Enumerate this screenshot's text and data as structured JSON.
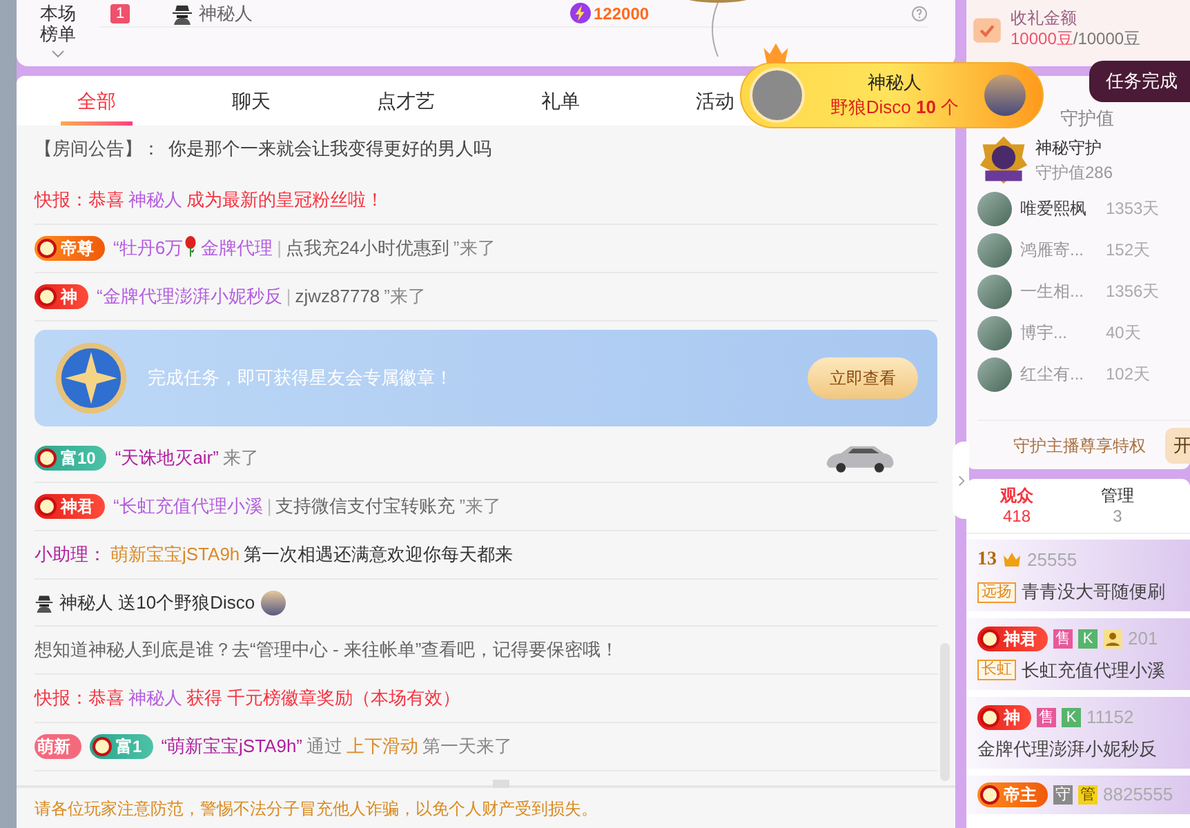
{
  "leaderboard": {
    "label": "本场榜单",
    "rank": "1",
    "name": "神秘人",
    "score": "122000"
  },
  "anchor_task": {
    "label": "收礼金额",
    "done": "10000豆",
    "total": "/10000豆"
  },
  "toast": "任务完成",
  "gift_banner": {
    "sender": "神秘人",
    "gift": "野狼Disco",
    "count": "10",
    "unit": "个"
  },
  "chat_tabs": [
    {
      "label": "全部",
      "selected": true
    },
    {
      "label": "聊天",
      "selected": false
    },
    {
      "label": "点才艺",
      "selected": false
    },
    {
      "label": "礼单",
      "selected": false
    },
    {
      "label": "活动",
      "selected": false
    }
  ],
  "announcement": {
    "label": "【房间公告】：",
    "text": "你是那个一来就会让我变得更好的男人吗"
  },
  "messages": [
    {
      "kind": "text",
      "segments": [
        {
          "kind": "alert",
          "text": "快报：恭喜"
        },
        {
          "kind": "name",
          "text": "神秘人"
        },
        {
          "kind": "alert",
          "text": "成为最新的皇冠粉丝啦！"
        }
      ]
    },
    {
      "kind": "text",
      "badges": [
        {
          "kind": "emperor",
          "label": "帝尊"
        }
      ],
      "segments": [
        {
          "kind": "name",
          "text": "“牡丹6万"
        },
        {
          "kind": "rose"
        },
        {
          "kind": "name",
          "text": "金牌代理"
        },
        {
          "kind": "sep",
          "text": "|"
        },
        {
          "kind": "body",
          "text": "点我充24小时优惠到"
        },
        {
          "kind": "muted",
          "text": "”来了"
        }
      ]
    },
    {
      "kind": "text",
      "badges": [
        {
          "kind": "god",
          "label": "神"
        }
      ],
      "segments": [
        {
          "kind": "name",
          "text": "“金牌代理澎湃小妮秒反"
        },
        {
          "kind": "sep",
          "text": "|"
        },
        {
          "kind": "body",
          "text": "zjwz87778"
        },
        {
          "kind": "muted",
          "text": "”来了"
        }
      ]
    },
    {
      "kind": "promo",
      "text": "完成任务，即可获得星友会专属徽章！",
      "button": "立即查看"
    },
    {
      "kind": "text",
      "car": true,
      "badges": [
        {
          "kind": "wealth",
          "label": "富10"
        }
      ],
      "segments": [
        {
          "kind": "vip",
          "text": "“天诛地灭air”"
        },
        {
          "kind": "muted",
          "text": "来了"
        }
      ]
    },
    {
      "kind": "text",
      "badges": [
        {
          "kind": "god",
          "label": "神君"
        }
      ],
      "segments": [
        {
          "kind": "name",
          "text": "“长虹充值代理小溪"
        },
        {
          "kind": "sep",
          "text": "|"
        },
        {
          "kind": "body",
          "text": "支持微信支付宝转账充"
        },
        {
          "kind": "muted",
          "text": "”来了"
        }
      ]
    },
    {
      "kind": "text",
      "segments": [
        {
          "kind": "vip",
          "text": "小助理："
        },
        {
          "kind": "accent",
          "text": "萌新宝宝jSTA9h"
        },
        {
          "kind": "dark",
          "text": "第一次相遇还满意欢迎你每天都来"
        }
      ]
    },
    {
      "kind": "gift",
      "sender": "神秘人",
      "text": "送10个野狼Disco"
    },
    {
      "kind": "text",
      "segments": [
        {
          "kind": "body",
          "text": "想知道神秘人到底是谁？去“管理中心 - 来往帐单”查看吧，记得要保密哦！"
        }
      ]
    },
    {
      "kind": "text",
      "segments": [
        {
          "kind": "alert",
          "text": "快报：恭喜"
        },
        {
          "kind": "name",
          "text": "神秘人"
        },
        {
          "kind": "alert",
          "text": "获得 千元榜徽章奖励（本场有效）"
        }
      ]
    },
    {
      "kind": "text",
      "badges": [
        {
          "kind": "newbie",
          "label": "萌新"
        },
        {
          "kind": "wealth",
          "label": "富1"
        }
      ],
      "segments": [
        {
          "kind": "vip",
          "text": "“萌新宝宝jSTA9h”"
        },
        {
          "kind": "muted",
          "text": "通过"
        },
        {
          "kind": "accent",
          "text": "上下滑动"
        },
        {
          "kind": "muted",
          "text": "第一天来了"
        }
      ]
    }
  ],
  "notice": "请各位玩家注意防范，警惕不法分子冒充他人诈骗，以免个人财产受到损失。",
  "guard_tab": "守护值",
  "guard": {
    "title": "神秘守护",
    "value": "守护值286"
  },
  "guardians": [
    {
      "name": "唯爱熙枫",
      "days": "1353天"
    },
    {
      "name": "鸿雁寄...",
      "days": "152天"
    },
    {
      "name": "一生相...",
      "days": "1356天"
    },
    {
      "name": "博宇...",
      "days": "40天"
    },
    {
      "name": "红尘有...",
      "days": "102天"
    }
  ],
  "privilege": {
    "label": "守护主播尊享特权",
    "button": "开"
  },
  "audience_tabs": [
    {
      "label": "观众",
      "count": "418",
      "selected": true
    },
    {
      "label": "管理",
      "count": "3",
      "selected": false
    }
  ],
  "users": [
    {
      "level": "13",
      "number": "25555",
      "tag": "远扬",
      "name": "青青没大哥随便刷"
    },
    {
      "badge": {
        "kind": "god",
        "label": "神君"
      },
      "marks": [
        {
          "kind": "sell",
          "label": "售"
        },
        {
          "kind": "k",
          "label": "K"
        },
        {
          "kind": "person"
        }
      ],
      "number": "201",
      "tag": "长虹",
      "name": "长虹充值代理小溪"
    },
    {
      "badge": {
        "kind": "god",
        "label": "神"
      },
      "marks": [
        {
          "kind": "sell",
          "label": "售"
        },
        {
          "kind": "k",
          "label": "K"
        }
      ],
      "number": "11152",
      "name": "金牌代理澎湃小妮秒反"
    },
    {
      "badge": {
        "kind": "emperor",
        "label": "帝主"
      },
      "marks": [
        {
          "kind": "guard",
          "label": "守"
        },
        {
          "kind": "admin",
          "label": "管"
        }
      ],
      "number": "8825555"
    }
  ]
}
